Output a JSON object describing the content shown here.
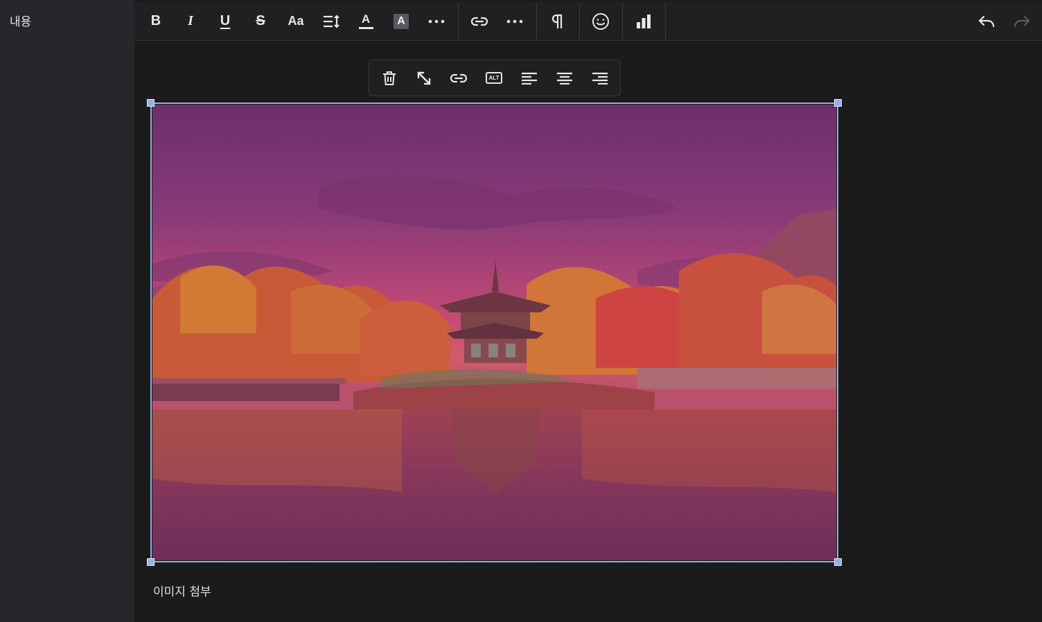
{
  "sidebar": {
    "label": "내용"
  },
  "toolbar": {
    "bold_label": "B",
    "italic_label": "I",
    "underline_label": "U",
    "strike_label": "S",
    "font_size_label": "Aa",
    "font_color_label": "A",
    "highlight_label": "A",
    "undo_icon": "undo-icon",
    "redo_icon": "redo-icon"
  },
  "image_toolbar": {
    "alt_label": "ALT"
  },
  "editor": {
    "caption": "이미지 첨부"
  },
  "colors": {
    "accent": "#8fb3e6",
    "background": "#1b1b1c",
    "sidebar": "#26272b",
    "toolbar": "#202022"
  }
}
